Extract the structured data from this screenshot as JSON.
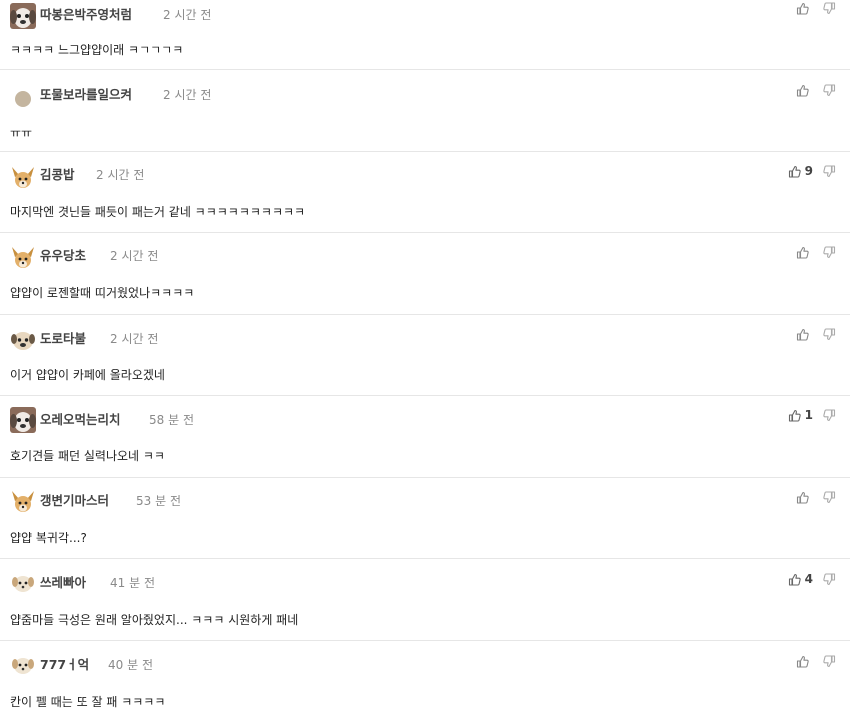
{
  "comments": [
    {
      "nickname": "따봉은박주영처럼",
      "time": "2 시간 전",
      "text": "ㅋㅋㅋㅋ 느그얍얍이래 ㅋㄱㄱㄱㅋ",
      "likes": "",
      "avatar": "white-dog-avatar"
    },
    {
      "nickname": "또물보라를일으켜",
      "time": "2 시간 전",
      "text": "ㅠㅠ",
      "likes": "",
      "avatar": "dot-avatar"
    },
    {
      "nickname": "김콩밥",
      "time": "2 시간 전",
      "text": "마지막엔 겻닌들 패듯이 패는거 같네 ㅋㅋㅋㅋㅋㅋㅋㅋㅋㅋ",
      "likes": "9",
      "avatar": "fawn-dog-avatar"
    },
    {
      "nickname": "유우당초",
      "time": "2 시간 전",
      "text": "얍얍이 로젠할때 띠거웠었나ㅋㅋㅋㅋ",
      "likes": "",
      "avatar": "fawn-dog-avatar"
    },
    {
      "nickname": "도로타불",
      "time": "2 시간 전",
      "text": "이거 얍얍이 카페에 올라오겠네",
      "likes": "",
      "avatar": "pug-avatar"
    },
    {
      "nickname": "오레오먹는리치",
      "time": "58 분 전",
      "text": "호기견들 패던 실력나오네 ㅋㅋ",
      "likes": "1",
      "avatar": "white-dog-avatar"
    },
    {
      "nickname": "갱변기마스터",
      "time": "53 분 전",
      "text": "얍얍 복귀각...?",
      "likes": "",
      "avatar": "fawn-dog-avatar"
    },
    {
      "nickname": "쓰레빠아",
      "time": "41 분 전",
      "text": "얍줌마들 극성은 원래 알아줬었지... ㅋㅋㅋ 시원하게 패네",
      "likes": "4",
      "avatar": "puppy-avatar"
    },
    {
      "nickname": "777ㅓ억",
      "time": "40 분 전",
      "text": "칸이 펠 때는 또 잘 패 ㅋㅋㅋㅋ",
      "likes": "",
      "avatar": "puppy-avatar"
    }
  ],
  "colors": {
    "nickname": "#444444",
    "time": "#8a8a8a",
    "text": "#222222",
    "divider": "#e6e6e6",
    "icon": "#888888"
  },
  "icons": {
    "like": "thumbs-up-icon",
    "dislike": "thumbs-down-icon"
  }
}
